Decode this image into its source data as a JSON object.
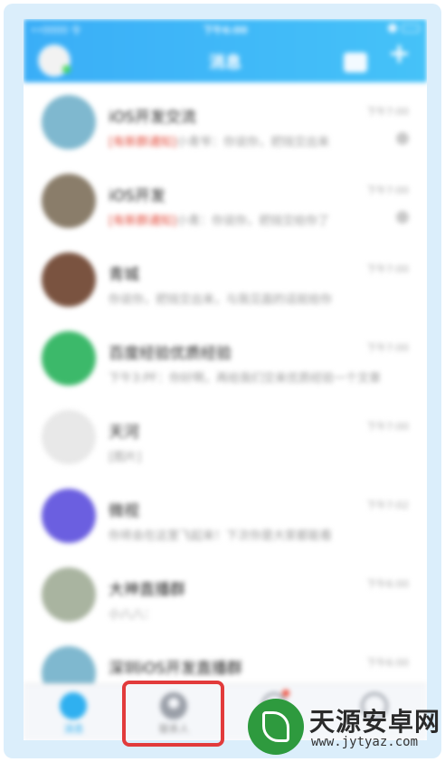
{
  "statusbar": {
    "carrier": "••0000 令",
    "time": "下午6:00"
  },
  "header": {
    "title": "消息"
  },
  "conversations": [
    {
      "name": "iOS开发交流",
      "time": "下午7:00",
      "tag": "[有新群通知]",
      "preview": "小青爷：你说你，把钱交出来",
      "muted": true,
      "avatar_color": "#7fb8cf"
    },
    {
      "name": "iOS开发",
      "time": "下午7:00",
      "tag": "[有新群通知]",
      "preview": "小青：你说你，把钱交给你了",
      "muted": true,
      "avatar_color": "#8a7d6a"
    },
    {
      "name": "青城",
      "time": "下午7:00",
      "tag": "",
      "preview": "你说你，把钱交出来，与我见面的话就给你",
      "muted": false,
      "avatar_color": "#7a5340"
    },
    {
      "name": "百度经验优质经验",
      "time": "下午7:00",
      "tag": "",
      "preview": "下午3:PF：你好啊，再给我们交来优质经验一个文章",
      "muted": false,
      "avatar_color": "#3cb96a"
    },
    {
      "name": "天河",
      "time": "下午7:00",
      "tag": "",
      "preview": "[图片]",
      "muted": false,
      "avatar_color": "#e8e8e8"
    },
    {
      "name": "微视",
      "time": "下午7:02",
      "tag": "",
      "preview": "你将会在这里飞起来！下次你是大家都能看",
      "muted": false,
      "avatar_color": "#6b5fe0"
    },
    {
      "name": "大神直播群",
      "time": "下午6:00",
      "tag": "",
      "preview": "小八八：",
      "muted": false,
      "avatar_color": "#a9b4a0"
    },
    {
      "name": "深圳iOS开发直播群",
      "time": "下午6:00",
      "tag": "",
      "preview": "",
      "muted": true,
      "avatar_color": "#7fb8cf"
    }
  ],
  "tabbar": {
    "messages_label": "消息",
    "contacts_label": "联系人",
    "discover_label": "",
    "other_label": ""
  },
  "watermark": {
    "brand": "天源安卓网",
    "url": "www.jytyaz.com"
  },
  "colors": {
    "header": "#3aaef7",
    "highlight": "#e23b3b",
    "accent": "#2fb0f0"
  }
}
